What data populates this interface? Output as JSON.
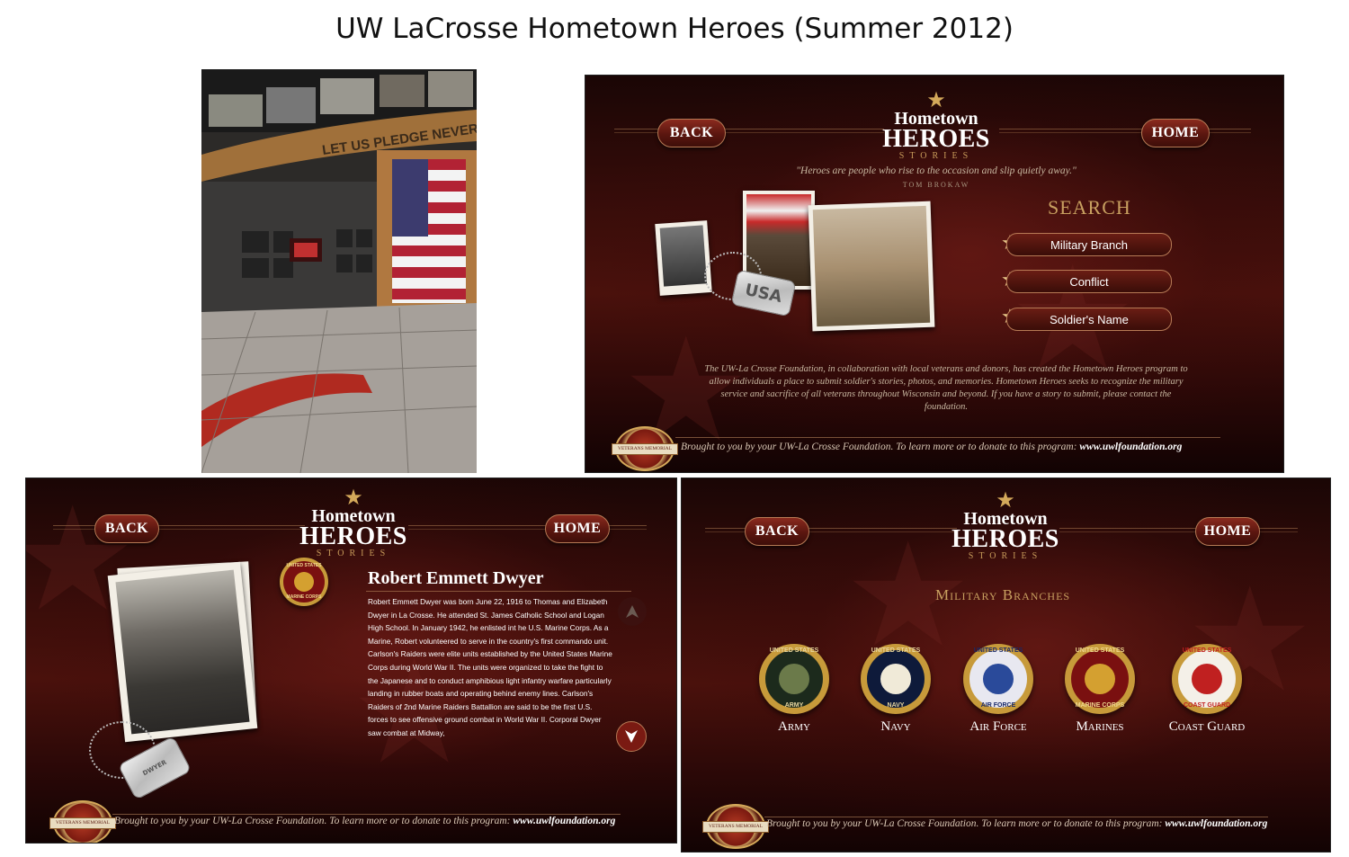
{
  "doc_title": "UW LaCrosse Hometown Heroes (Summer 2012)",
  "photo": {
    "wall_text": "LET US PLEDGE NEVER TO"
  },
  "nav": {
    "back": "BACK",
    "home": "HOME"
  },
  "logo": {
    "line1": "Hometown",
    "line2": "HEROES",
    "line3": "STORIES"
  },
  "search_screen": {
    "quote": "\"Heroes are people who rise to the occasion and slip quietly away.\"",
    "quote_author": "TOM BROKAW",
    "title": "SEARCH",
    "buttons": [
      "Military Branch",
      "Conflict",
      "Soldier's Name"
    ],
    "dogtag": "USA",
    "description": "The UW-La Crosse Foundation, in collaboration with local veterans and donors, has created the Hometown Heroes program to allow individuals a place to submit soldier's stories, photos, and memories. Hometown Heroes seeks to recognize the military service and sacrifice of all veterans throughout Wisconsin and beyond. If you have a story to submit, please contact the foundation."
  },
  "footer": {
    "text": "Brought to you by your UW-La Crosse Foundation. To learn more or to donate to this program:",
    "url": "www.uwlfoundation.org",
    "seal_text": "VETERANS MEMORIAL"
  },
  "bio_screen": {
    "name": "Robert Emmett Dwyer",
    "dogtag": "DWYER",
    "badge_top": "UNITED STATES",
    "badge_bottom": "MARINE CORPS",
    "text": "Robert Emmett Dwyer was born June 22, 1916 to Thomas and Elizabeth Dwyer in La Crosse. He attended St. James Catholic School and Logan High School. In January 1942, he enlisted int he U.S. Marine Corps. As a Marine, Robert volunteered to serve in the country's first commando unit. Carlson's Raiders were elite units established by the United States Marine Corps during World War II. The units were organized to take the fight to the Japanese and to conduct amphibious light infantry warfare particularly landing in rubber boats and operating behind enemy lines. Carlson's Raiders of 2nd Marine Raiders Battallion are said to be the first U.S. forces to see offensive ground combat in World War II. Corporal Dwyer saw combat at Midway,"
  },
  "branches_screen": {
    "title": "Military Branches",
    "branches": [
      {
        "label": "Army",
        "top": "UNITED STATES",
        "bottom": "ARMY",
        "ring": "#1c2a1c",
        "emb": "#6b7a4a",
        "txt": "#e8d7a0",
        "rim": "#c79a3a"
      },
      {
        "label": "Navy",
        "top": "UNITED STATES",
        "bottom": "NAVY",
        "ring": "#0e1a3a",
        "emb": "#f0ead8",
        "txt": "#e8d7a0",
        "rim": "#c79a3a"
      },
      {
        "label": "Air Force",
        "top": "UNITED STATES",
        "bottom": "AIR FORCE",
        "ring": "#e8e8f0",
        "emb": "#2a4a9a",
        "txt": "#1a2a6a",
        "rim": "#c79a3a"
      },
      {
        "label": "Marines",
        "top": "UNITED STATES",
        "bottom": "MARINE CORPS",
        "ring": "#7a1010",
        "emb": "#d4a030",
        "txt": "#f0d890",
        "rim": "#c79a3a"
      },
      {
        "label": "Coast Guard",
        "top": "UNITED STATES",
        "bottom": "COAST GUARD",
        "ring": "#f4f0e8",
        "emb": "#c02020",
        "txt": "#c02020",
        "rim": "#c79a3a"
      }
    ]
  }
}
